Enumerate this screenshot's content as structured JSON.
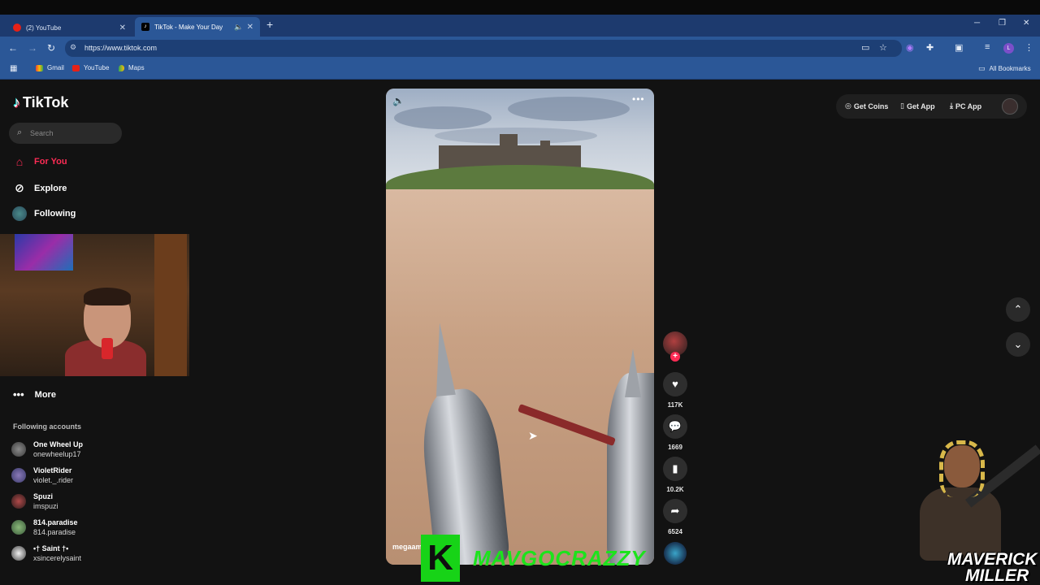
{
  "browser": {
    "tabs": [
      {
        "title": "(2) YouTube",
        "active": false,
        "favicon": "youtube-icon"
      },
      {
        "title": "TikTok - Make Your Day",
        "active": true,
        "favicon": "tiktok-icon",
        "audio": true
      }
    ],
    "url": "https://www.tiktok.com",
    "bookmarks": [
      {
        "label": "Gmail",
        "icon": "gmail-icon"
      },
      {
        "label": "YouTube",
        "icon": "youtube-icon"
      },
      {
        "label": "Maps",
        "icon": "maps-icon"
      }
    ],
    "all_bookmarks": "All Bookmarks",
    "profile_initial": "L"
  },
  "tiktok": {
    "brand": "TikTok",
    "search_placeholder": "Search",
    "nav": [
      {
        "label": "For You",
        "icon": "home-icon",
        "active": true
      },
      {
        "label": "Explore",
        "icon": "compass-icon",
        "active": false
      },
      {
        "label": "Following",
        "icon": "following-avatar",
        "active": false
      }
    ],
    "more_label": "More",
    "following_title": "Following accounts",
    "following_accounts": [
      {
        "name": "One Wheel Up",
        "handle": "onewheelup17"
      },
      {
        "name": "VioletRider",
        "handle": "violet._.rider"
      },
      {
        "name": "Spuzi",
        "handle": "imspuzi"
      },
      {
        "name": "814.paradise",
        "handle": "814.paradise"
      },
      {
        "name": "•† Saint †•",
        "handle": "xsincerelysaint"
      }
    ],
    "video": {
      "creator": "megaam"
    },
    "actions": {
      "likes": "117K",
      "comments": "1669",
      "saves": "10.2K",
      "shares": "6524"
    },
    "top_right": {
      "get_coins": "Get Coins",
      "get_app": "Get App",
      "pc_app": "PC App"
    }
  },
  "overlay": {
    "stream_logo_letter": "K",
    "stream_text": "MAVGOCRAZZY",
    "name_line1": "MAVERICK",
    "name_line2": "MILLER"
  },
  "colors": {
    "tiktok_red": "#fe2c55",
    "chrome_blue": "#2b5797",
    "overlay_green": "#1ce31c"
  }
}
